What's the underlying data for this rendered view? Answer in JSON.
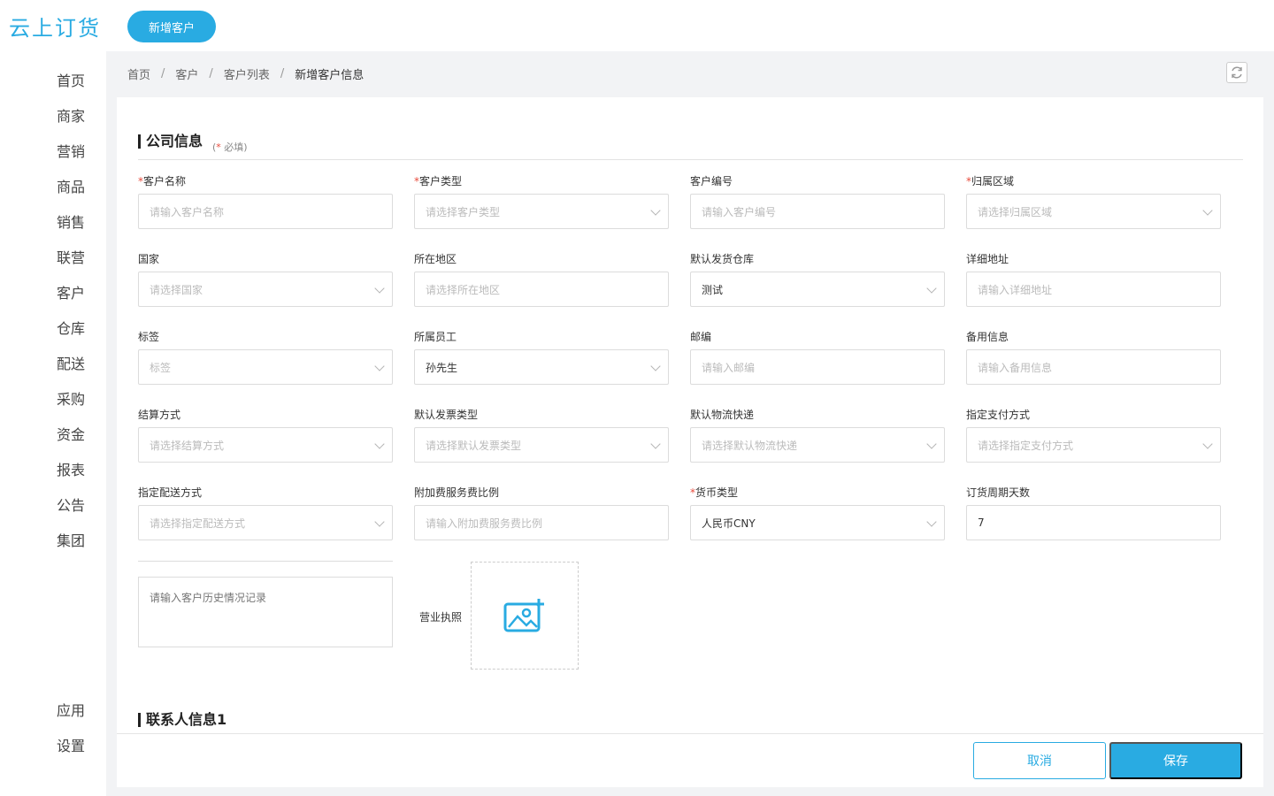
{
  "app": {
    "logo": "云上订货",
    "new_button": "新增客户"
  },
  "sidebar": {
    "top_items": [
      "首页",
      "商家",
      "营销",
      "商品",
      "销售",
      "联营",
      "客户",
      "仓库",
      "配送",
      "采购",
      "资金",
      "报表",
      "公告",
      "集团"
    ],
    "bottom_items": [
      "应用",
      "设置"
    ]
  },
  "breadcrumb": {
    "items": [
      "首页",
      "客户",
      "客户列表"
    ],
    "current": "新增客户信息",
    "separator": "/"
  },
  "section_company": {
    "title": "公司信息",
    "hint_star": "*",
    "hint_text": " 必填"
  },
  "form": {
    "fields": [
      {
        "label": "客户名称",
        "required": true,
        "placeholder": "请输入客户名称",
        "value": "",
        "select": false
      },
      {
        "label": "客户类型",
        "required": true,
        "placeholder": "请选择客户类型",
        "value": "",
        "select": true
      },
      {
        "label": "客户编号",
        "required": false,
        "placeholder": "请输入客户编号",
        "value": "",
        "select": false
      },
      {
        "label": "归属区域",
        "required": true,
        "placeholder": "请选择归属区域",
        "value": "",
        "select": true
      },
      {
        "label": "国家",
        "required": false,
        "placeholder": "请选择国家",
        "value": "",
        "select": true
      },
      {
        "label": "所在地区",
        "required": false,
        "placeholder": "请选择所在地区",
        "value": "",
        "select": false
      },
      {
        "label": "默认发货仓库",
        "required": false,
        "placeholder": "",
        "value": "测试",
        "select": true
      },
      {
        "label": "详细地址",
        "required": false,
        "placeholder": "请输入详细地址",
        "value": "",
        "select": false
      },
      {
        "label": "标签",
        "required": false,
        "placeholder": "标签",
        "value": "",
        "select": true
      },
      {
        "label": "所属员工",
        "required": false,
        "placeholder": "",
        "value": "孙先生",
        "select": true
      },
      {
        "label": "邮编",
        "required": false,
        "placeholder": "请输入邮编",
        "value": "",
        "select": false
      },
      {
        "label": "备用信息",
        "required": false,
        "placeholder": "请输入备用信息",
        "value": "",
        "select": false
      },
      {
        "label": "结算方式",
        "required": false,
        "placeholder": "请选择结算方式",
        "value": "",
        "select": true
      },
      {
        "label": "默认发票类型",
        "required": false,
        "placeholder": "请选择默认发票类型",
        "value": "",
        "select": true
      },
      {
        "label": "默认物流快递",
        "required": false,
        "placeholder": "请选择默认物流快递",
        "value": "",
        "select": true
      },
      {
        "label": "指定支付方式",
        "required": false,
        "placeholder": "请选择指定支付方式",
        "value": "",
        "select": true
      },
      {
        "label": "指定配送方式",
        "required": false,
        "placeholder": "请选择指定配送方式",
        "value": "",
        "select": true
      },
      {
        "label": "附加费服务费比例",
        "required": false,
        "placeholder": "请输入附加费服务费比例",
        "value": "",
        "select": false
      },
      {
        "label": "货币类型",
        "required": true,
        "placeholder": "",
        "value": "人民币CNY",
        "select": true
      },
      {
        "label": "订货周期天数",
        "required": false,
        "placeholder": "",
        "value": "7",
        "select": false
      }
    ],
    "history_placeholder": "请输入客户历史情况记录",
    "license_label": "营业执照"
  },
  "section_contact": {
    "title": "联系人信息1"
  },
  "footer": {
    "cancel": "取消",
    "save": "保存"
  },
  "colors": {
    "accent": "#29abe2",
    "required": "#e84b3c"
  }
}
